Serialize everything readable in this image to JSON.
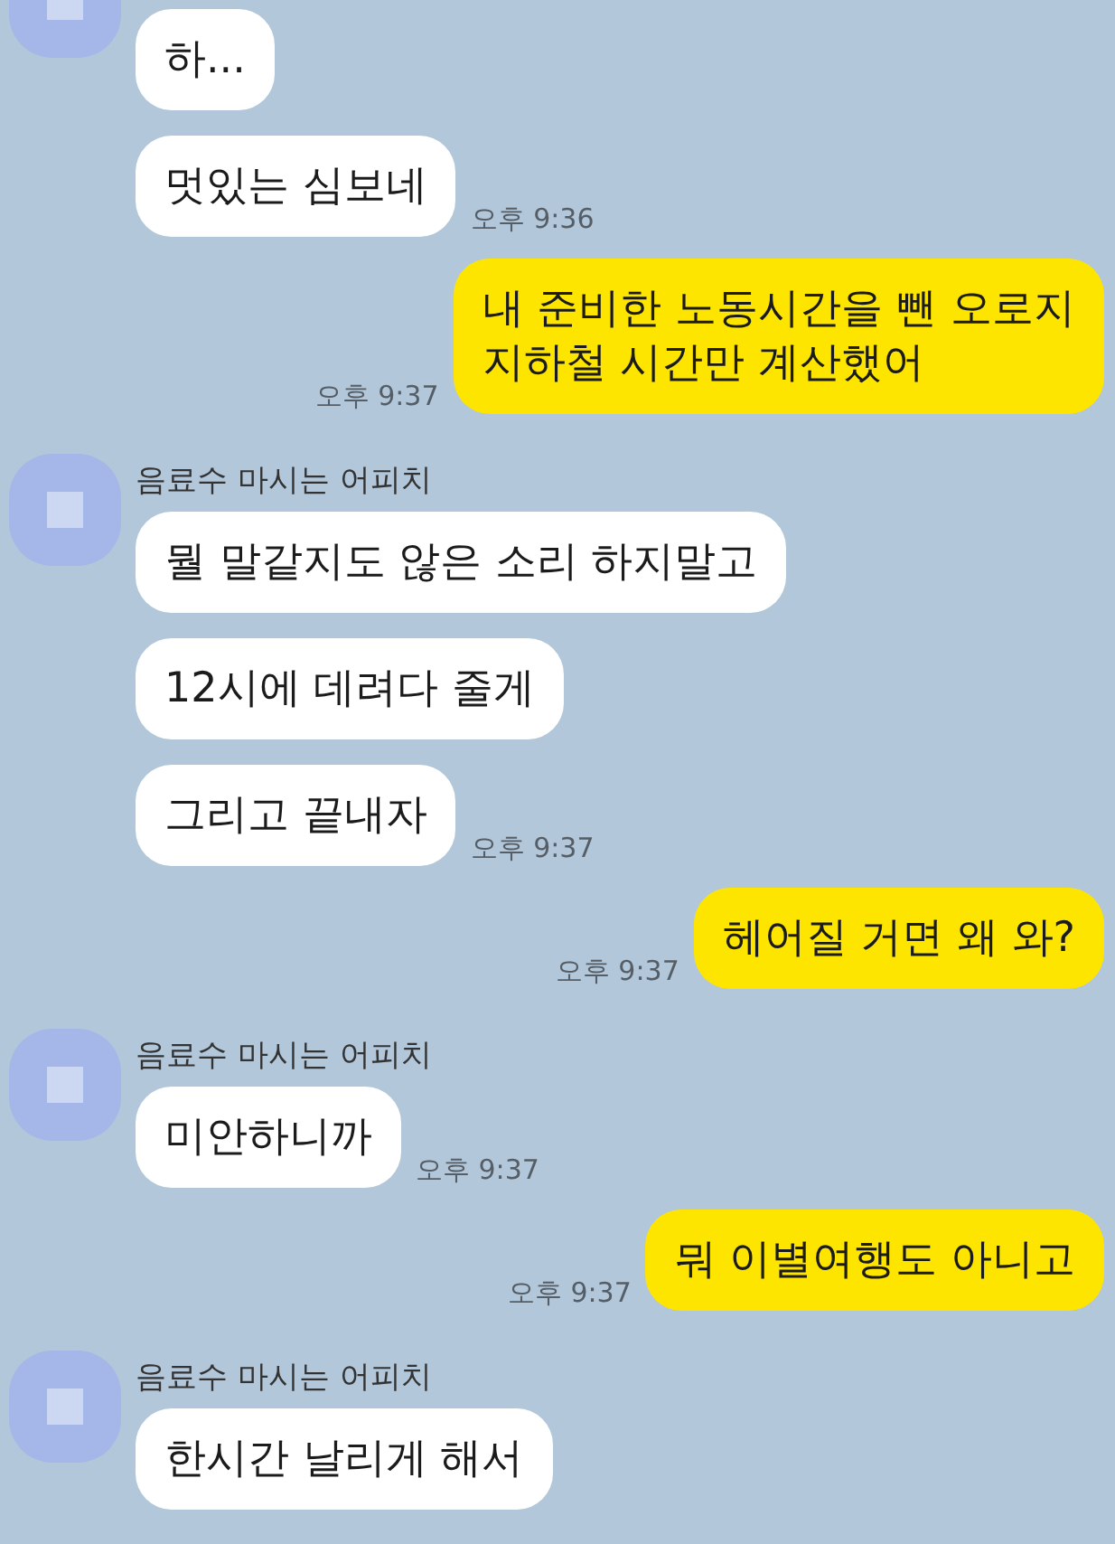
{
  "groups": [
    {
      "kind": "received",
      "messages": [
        {
          "text": "하..."
        },
        {
          "text": "멋있는 심보네",
          "time": "오후 9:36"
        }
      ]
    },
    {
      "kind": "sent",
      "messages": [
        {
          "text": "내 준비한 노동시간을 뺀 오로지\n지하철 시간만 계산했어",
          "time": "오후 9:37"
        }
      ]
    },
    {
      "kind": "received",
      "sender": "음료수 마시는 어피치",
      "messages": [
        {
          "text": "뭘 말같지도 않은 소리 하지말고"
        },
        {
          "text": "12시에 데려다 줄게"
        },
        {
          "text": "그리고 끝내자",
          "time": "오후 9:37"
        }
      ]
    },
    {
      "kind": "sent",
      "messages": [
        {
          "text": "헤어질 거면 왜 와?",
          "time": "오후 9:37"
        }
      ]
    },
    {
      "kind": "received",
      "sender": "음료수 마시는 어피치",
      "messages": [
        {
          "text": "미안하니까",
          "time": "오후 9:37"
        }
      ]
    },
    {
      "kind": "sent",
      "messages": [
        {
          "text": "뭐 이별여행도 아니고",
          "time": "오후 9:37"
        }
      ]
    },
    {
      "kind": "received",
      "sender": "음료수 마시는 어피치",
      "messages": [
        {
          "text": "한시간 날리게 해서"
        }
      ]
    }
  ]
}
